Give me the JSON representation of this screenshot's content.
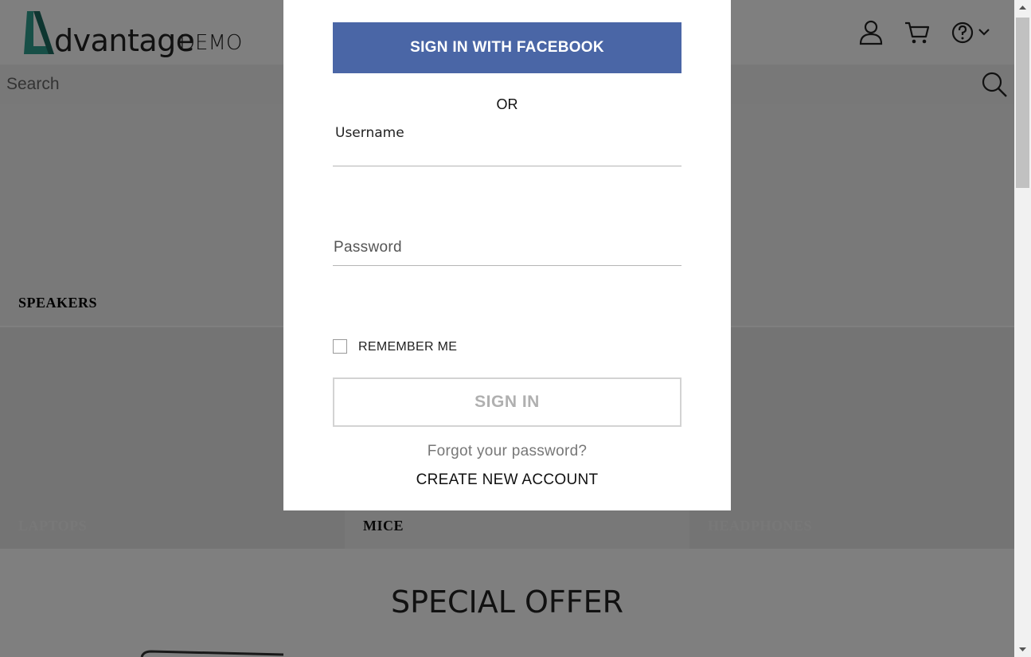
{
  "header": {
    "logo_word": "dvantage",
    "logo_demo": "DEMO",
    "icons": [
      "user-icon",
      "cart-icon",
      "help-icon",
      "chevron-down-icon"
    ]
  },
  "search": {
    "placeholder": "Search"
  },
  "categories": [
    {
      "label": "SPEAKERS",
      "color": "#111111"
    },
    {
      "label": "LAPTOPS",
      "color": "#f0f0f0"
    },
    {
      "label": "MICE",
      "color": "#111111"
    },
    {
      "label": "HEADPHONES",
      "color": "#f0f0f0"
    }
  ],
  "special_offer": {
    "title": "SPECIAL OFFER"
  },
  "login_modal": {
    "facebook_button": "SIGN IN WITH FACEBOOK",
    "or_text": "OR",
    "username_label": "Username",
    "password_label": "Password",
    "remember_me": "REMEMBER ME",
    "sign_in_button": "SIGN IN",
    "forgot_password": "Forgot your password?",
    "create_account": "CREATE NEW ACCOUNT"
  },
  "colors": {
    "facebook_blue": "#4a66a6",
    "brand_teal": "#2f9e8e",
    "overlay": "rgba(0,0,0,0.5)"
  }
}
